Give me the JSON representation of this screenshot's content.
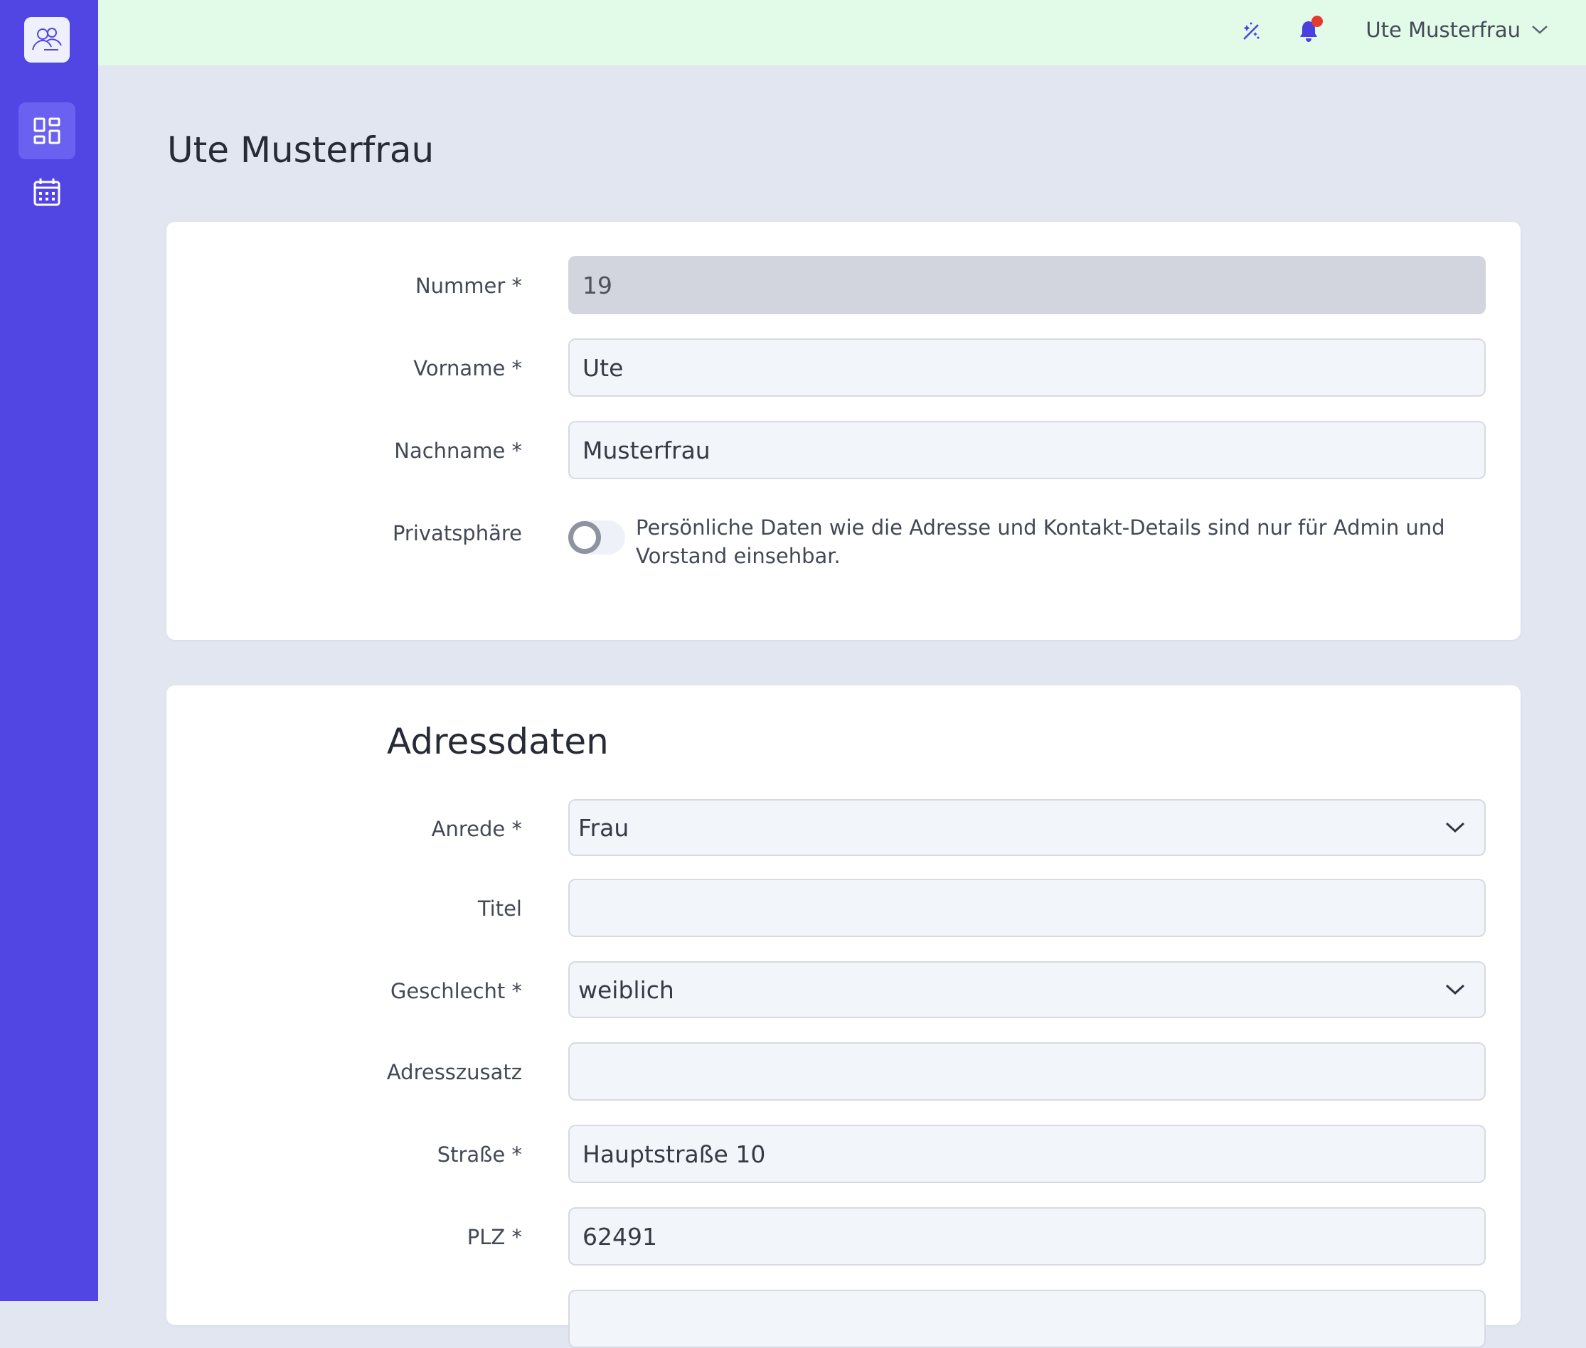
{
  "header": {
    "user_name": "Ute Musterfrau",
    "icons": {
      "magic": "magic-wand-icon",
      "bell": "bell-icon",
      "chevron": "chevron-down-icon"
    }
  },
  "sidebar": {
    "logo": "users-logo-icon",
    "items": [
      {
        "name": "dashboard",
        "icon": "dashboard-icon",
        "active": true
      },
      {
        "name": "calendar",
        "icon": "calendar-icon",
        "active": false
      }
    ]
  },
  "page": {
    "title": "Ute Musterfrau"
  },
  "person": {
    "nummer": {
      "label": "Nummer *",
      "value": "19"
    },
    "vorname": {
      "label": "Vorname *",
      "value": "Ute"
    },
    "nachname": {
      "label": "Nachname *",
      "value": "Musterfrau"
    },
    "privacy": {
      "label": "Privatsphäre",
      "enabled": false,
      "description": "Persönliche Daten wie die Adresse und Kontakt-Details sind nur für Admin und Vorstand einsehbar."
    }
  },
  "address": {
    "title": "Adressdaten",
    "anrede": {
      "label": "Anrede *",
      "value": "Frau"
    },
    "titel": {
      "label": "Titel",
      "value": ""
    },
    "geschlecht": {
      "label": "Geschlecht *",
      "value": "weiblich"
    },
    "adresszusatz": {
      "label": "Adresszusatz",
      "value": ""
    },
    "strasse": {
      "label": "Straße *",
      "value": "Hauptstraße 10"
    },
    "plz": {
      "label": "PLZ *",
      "value": "62491"
    }
  },
  "colors": {
    "sidebar": "#5145e3",
    "topbar": "#e2fae8",
    "background": "#e1e6f0",
    "accent": "#4a3fe0",
    "notification": "#e5392f"
  }
}
